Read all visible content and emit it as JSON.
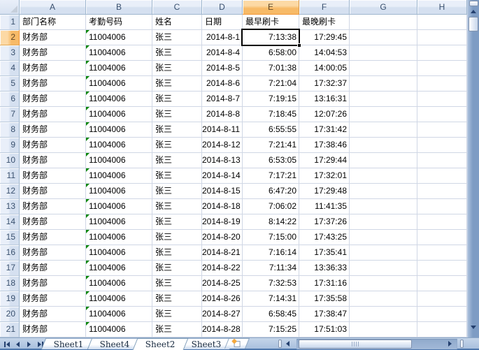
{
  "grid": {
    "column_letters": [
      "A",
      "B",
      "C",
      "D",
      "E",
      "F",
      "G",
      "H"
    ],
    "row_numbers_visible": 21,
    "header_row": [
      "部门名称",
      "考勤号码",
      "姓名",
      "日期",
      "最早刷卡",
      "最晚刷卡"
    ],
    "data_rows": [
      [
        "财务部",
        "11004006",
        "张三",
        "2014-8-1",
        "7:13:38",
        "17:29:45"
      ],
      [
        "财务部",
        "11004006",
        "张三",
        "2014-8-4",
        "6:58:00",
        "14:04:53"
      ],
      [
        "财务部",
        "11004006",
        "张三",
        "2014-8-5",
        "7:01:38",
        "14:00:05"
      ],
      [
        "财务部",
        "11004006",
        "张三",
        "2014-8-6",
        "7:21:04",
        "17:32:37"
      ],
      [
        "财务部",
        "11004006",
        "张三",
        "2014-8-7",
        "7:19:15",
        "13:16:31"
      ],
      [
        "财务部",
        "11004006",
        "张三",
        "2014-8-8",
        "7:18:45",
        "12:07:26"
      ],
      [
        "财务部",
        "11004006",
        "张三",
        "2014-8-11",
        "6:55:55",
        "17:31:42"
      ],
      [
        "财务部",
        "11004006",
        "张三",
        "2014-8-12",
        "7:21:41",
        "17:38:46"
      ],
      [
        "财务部",
        "11004006",
        "张三",
        "2014-8-13",
        "6:53:05",
        "17:29:44"
      ],
      [
        "财务部",
        "11004006",
        "张三",
        "2014-8-14",
        "7:17:21",
        "17:32:01"
      ],
      [
        "财务部",
        "11004006",
        "张三",
        "2014-8-15",
        "6:47:20",
        "17:29:48"
      ],
      [
        "财务部",
        "11004006",
        "张三",
        "2014-8-18",
        "7:06:02",
        "11:41:35"
      ],
      [
        "财务部",
        "11004006",
        "张三",
        "2014-8-19",
        "8:14:22",
        "17:37:26"
      ],
      [
        "财务部",
        "11004006",
        "张三",
        "2014-8-20",
        "7:15:00",
        "17:43:25"
      ],
      [
        "财务部",
        "11004006",
        "张三",
        "2014-8-21",
        "7:16:14",
        "17:35:41"
      ],
      [
        "财务部",
        "11004006",
        "张三",
        "2014-8-22",
        "7:11:34",
        "13:36:33"
      ],
      [
        "财务部",
        "11004006",
        "张三",
        "2014-8-25",
        "7:32:53",
        "17:31:16"
      ],
      [
        "财务部",
        "11004006",
        "张三",
        "2014-8-26",
        "7:14:31",
        "17:35:58"
      ],
      [
        "财务部",
        "11004006",
        "张三",
        "2014-8-27",
        "6:58:45",
        "17:38:47"
      ],
      [
        "财务部",
        "11004006",
        "张三",
        "2014-8-28",
        "7:15:25",
        "17:51:03"
      ]
    ],
    "text_format_indicator_column": "B"
  },
  "selection": {
    "cell_ref": "E2",
    "column": "E",
    "row": 2,
    "value": "7:13:38"
  },
  "tabbar": {
    "nav_buttons": [
      "first-sheet",
      "previous-sheet",
      "next-sheet",
      "last-sheet"
    ],
    "tabs": [
      {
        "label": "Sheet1",
        "active": false
      },
      {
        "label": "Sheet4",
        "active": false
      },
      {
        "label": "Sheet2",
        "active": true
      },
      {
        "label": "Sheet3",
        "active": false
      }
    ],
    "insert_worksheet_icon": "insert-worksheet-icon"
  },
  "colors": {
    "header_bg_top": "#E9EFF9",
    "header_bg_bottom": "#D5E0F0",
    "header_border": "#9EB6CE",
    "selected_header_top": "#FCD9A5",
    "selected_header_bottom": "#F7BA67",
    "selected_header_accent": "#F29536",
    "gridline": "#D0D7E5",
    "text_format_triangle": "#098609",
    "tabbar_bg": "#A9C0DE",
    "scrollbar_track": "#7E9CC4",
    "scroll_arrow": "#24406F",
    "window_bottom_edge": "#4E76AB"
  }
}
